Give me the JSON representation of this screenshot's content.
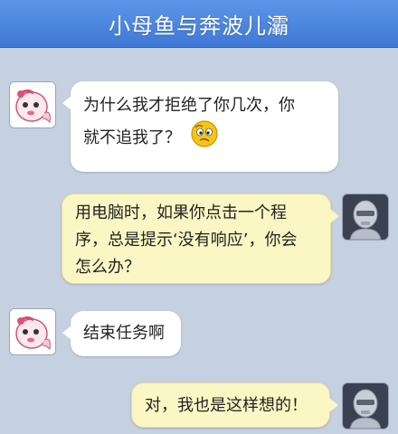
{
  "header": {
    "title": "小母鱼与奔波儿灞"
  },
  "messages": [
    {
      "side": "left",
      "sender_avatar": "cartoon-fish-avatar",
      "lines": [
        "为什么我才拒绝了你几次，你",
        "就不追我了？"
      ],
      "emoji": "thinking-emoji"
    },
    {
      "side": "right",
      "sender_avatar": "robot-avatar",
      "lines": [
        "用电脑时，如果你点击一个程",
        "序，总是提示‘没有响应’，你会",
        "怎么办？"
      ]
    },
    {
      "side": "left",
      "sender_avatar": "cartoon-fish-avatar",
      "lines": [
        "结束任务啊"
      ]
    },
    {
      "side": "right",
      "sender_avatar": "robot-avatar",
      "lines": [
        "对，我也是这样想的！"
      ]
    }
  ],
  "colors": {
    "header": "#4a85df",
    "background": "#c5d0e0",
    "left_bubble": "#ffffff",
    "right_bubble": "#fbf7c4"
  }
}
